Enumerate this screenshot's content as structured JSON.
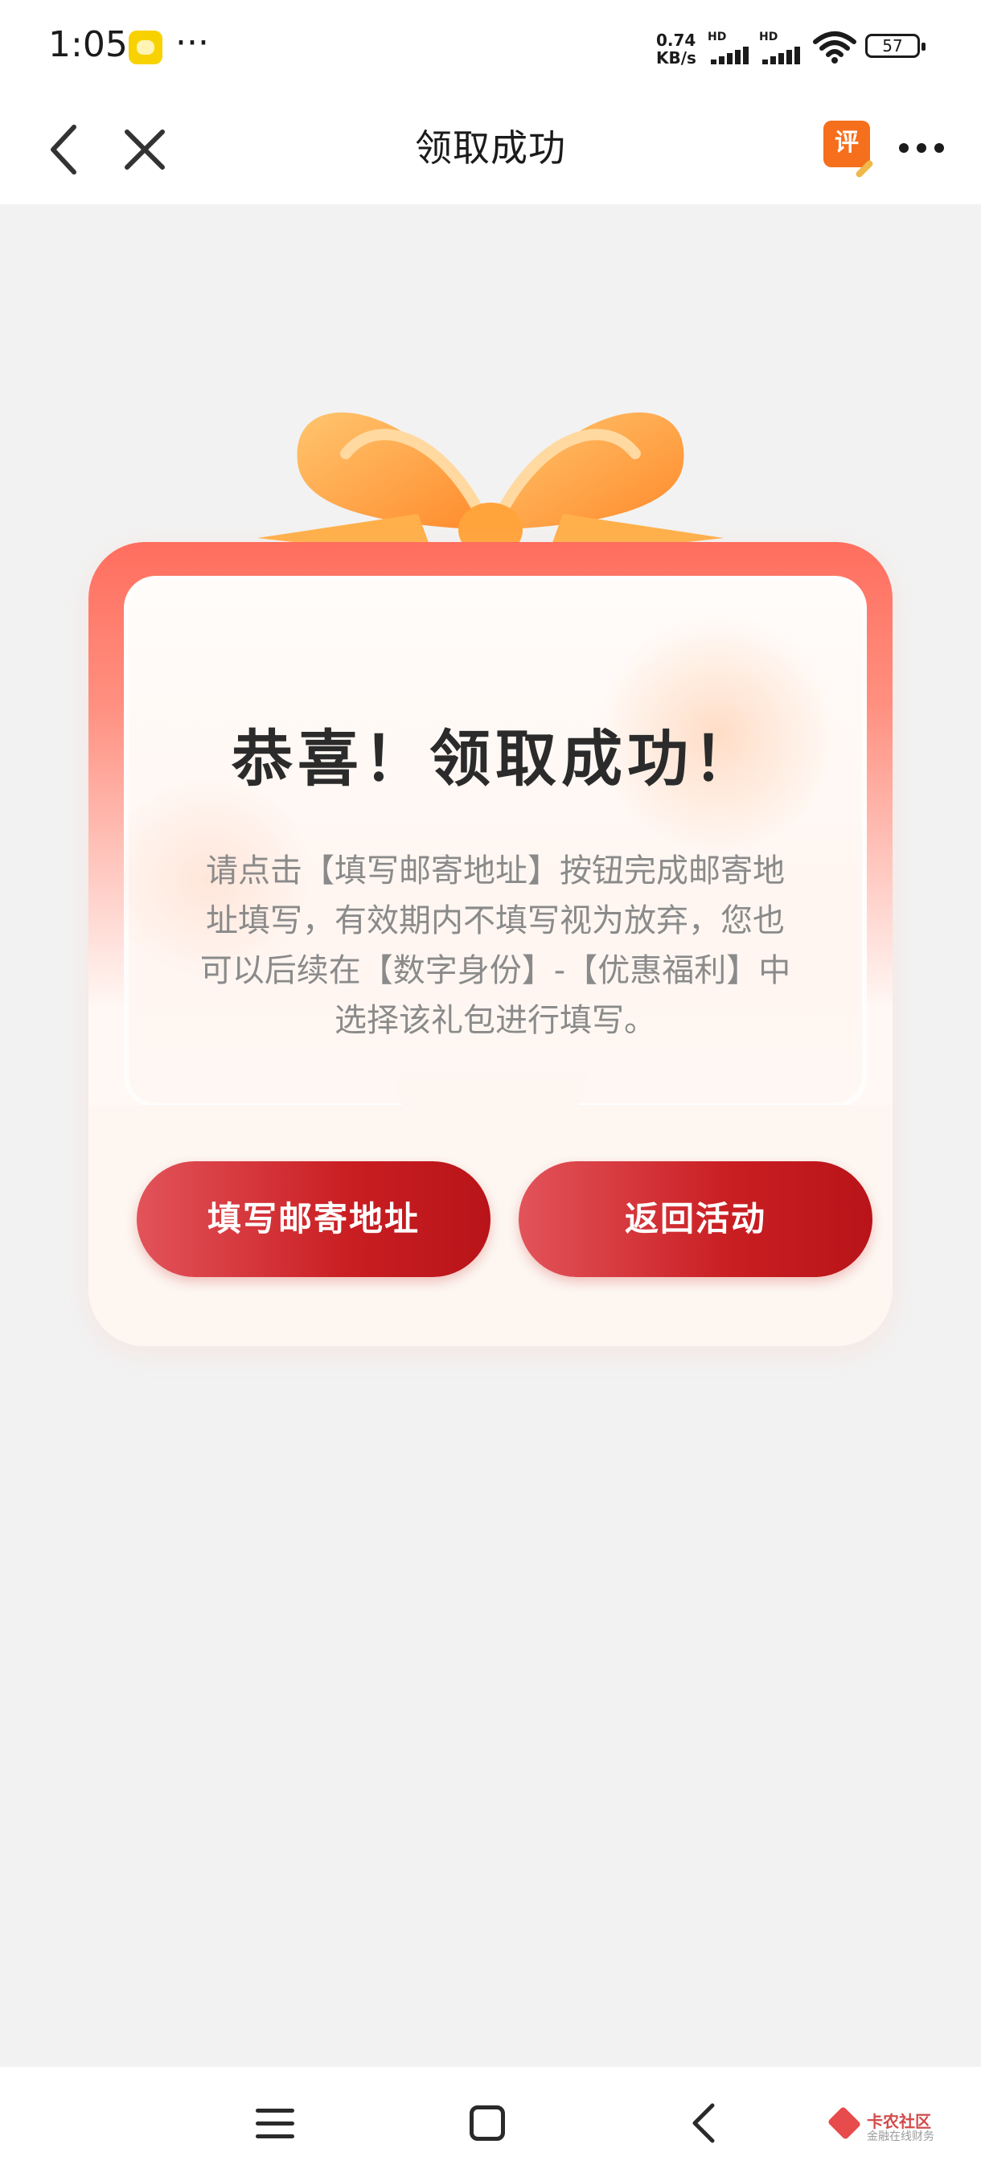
{
  "status_bar": {
    "time": "1:05",
    "more": "···",
    "net_speed_value": "0.74",
    "net_speed_unit": "KB/s",
    "signal_label_1": "HD",
    "signal_label_2": "HD",
    "battery": "57"
  },
  "header": {
    "title": "领取成功",
    "review_badge": "评",
    "icons": [
      "back-icon",
      "close-icon",
      "review-icon",
      "more-icon"
    ]
  },
  "card": {
    "heading": "恭喜！领取成功！",
    "description": "请点击【填写邮寄地址】按钮完成邮寄地址填写，有效期内不填写视为放弃，您也可以后续在【数字身份】-【优惠福利】中选择该礼包进行填写。",
    "buttons": {
      "fill_address": "填写邮寄地址",
      "return_activity": "返回活动"
    }
  },
  "watermark": {
    "title": "卡农社区",
    "subtitle": "金融在线财务"
  },
  "colors": {
    "button_red": "#c91e22",
    "card_top": "#ff6e5e",
    "bow_orange": "#ff9a3c"
  }
}
